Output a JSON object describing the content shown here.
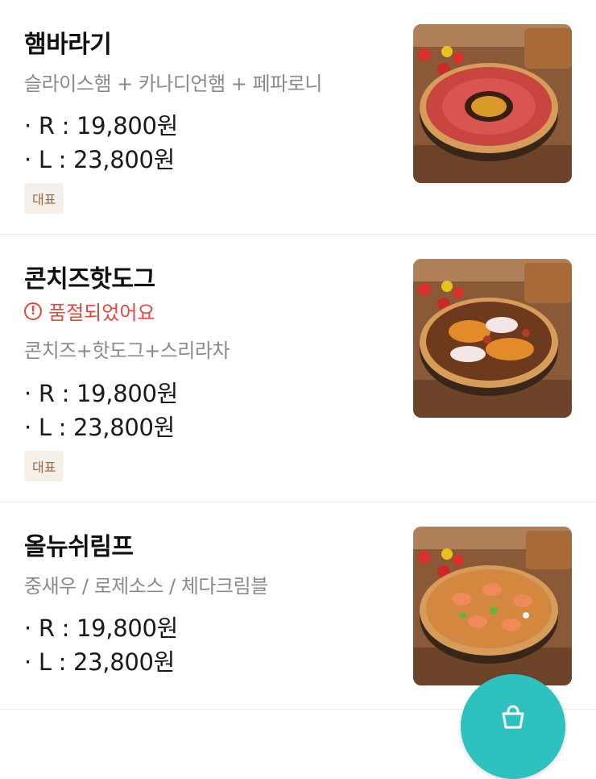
{
  "menu": {
    "items": [
      {
        "name": "햄바라기",
        "description": "슬라이스햄 + 카나디언햄 + 페파로니",
        "price_r": "· R : 19,800원",
        "price_l": "· L : 23,800원",
        "badge": "대표"
      },
      {
        "name": "콘치즈핫도그",
        "status": "품절되었어요",
        "description": "콘치즈+핫도그+스리라차",
        "price_r": "· R : 19,800원",
        "price_l": "· L : 23,800원",
        "badge": "대표"
      },
      {
        "name": "올뉴쉬림프",
        "description": "중새우 / 로제소스 / 체다크림블",
        "price_r": "· R : 19,800원",
        "price_l": "· L : 23,800원"
      }
    ]
  },
  "status_icon": "!",
  "fab": {
    "icon": "cart-icon",
    "color": "#2fc1bd"
  },
  "colors": {
    "soldout": "#e4473f",
    "badge_bg": "#f4efe9",
    "badge_text": "#9a6a43"
  }
}
